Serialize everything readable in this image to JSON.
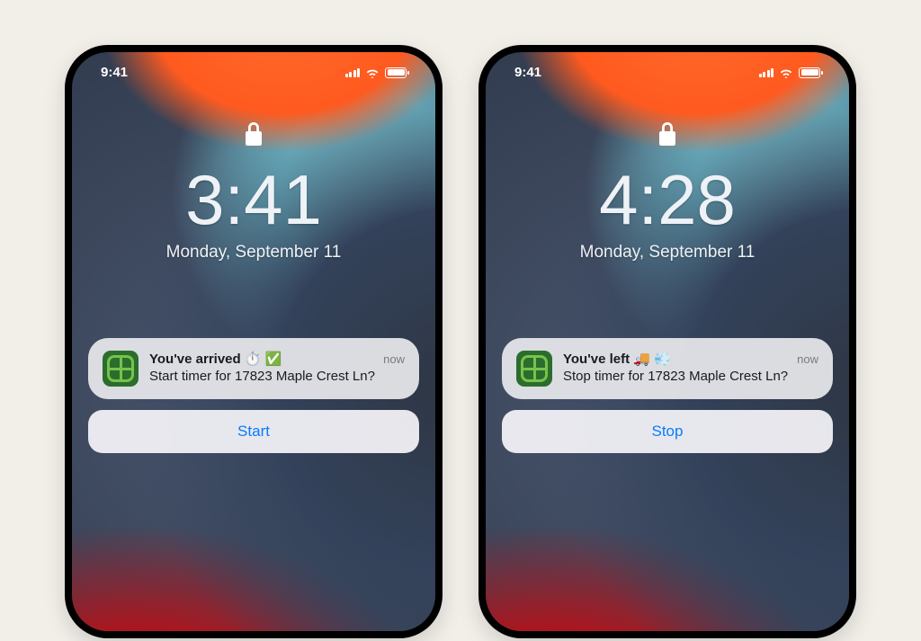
{
  "phones": [
    {
      "status_time": "9:41",
      "lock_time": "3:41",
      "date": "Monday, September 11",
      "notification": {
        "title": "You've arrived ⏱️ ✅",
        "timestamp": "now",
        "message": "Start timer for 17823 Maple Crest Ln?"
      },
      "action_label": "Start"
    },
    {
      "status_time": "9:41",
      "lock_time": "4:28",
      "date": "Monday, September 11",
      "notification": {
        "title": "You've left 🚚 💨",
        "timestamp": "now",
        "message": "Stop timer for 17823 Maple Crest Ln?"
      },
      "action_label": "Stop"
    }
  ]
}
